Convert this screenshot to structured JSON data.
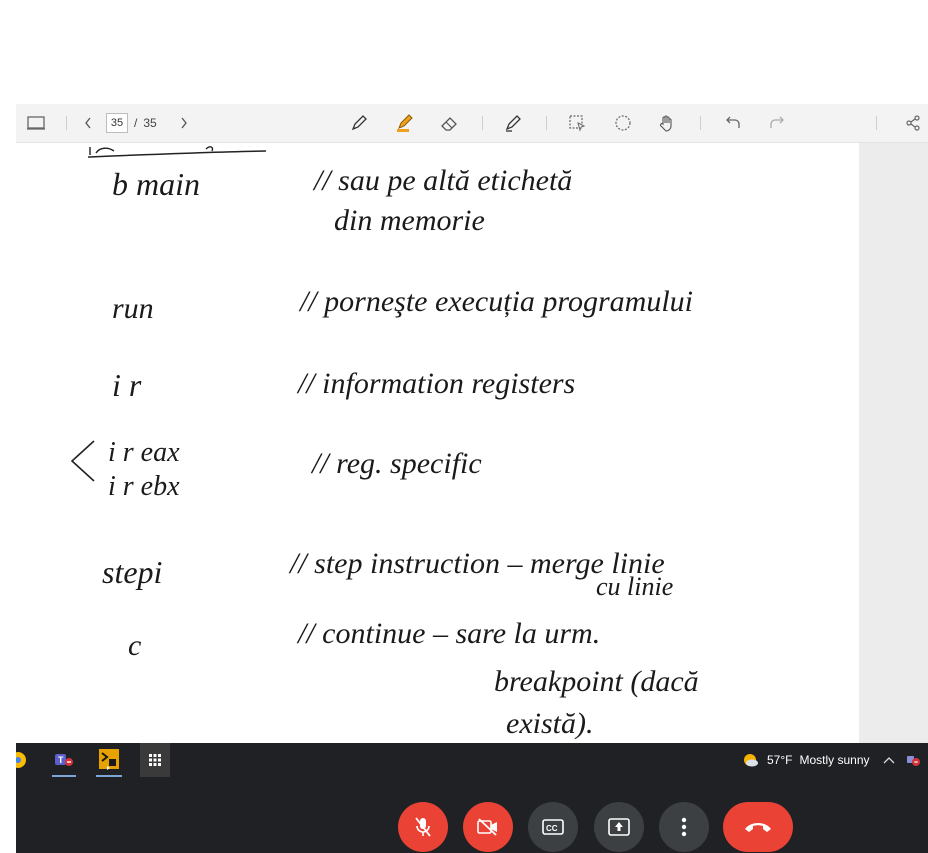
{
  "pdf_toolbar": {
    "current_page": "35",
    "total_pages": "35",
    "separator": "/"
  },
  "notes": {
    "lines": [
      {
        "cmd": "b  main",
        "comment": "// sau pe altă etichetă",
        "comment2": "din memorie"
      },
      {
        "cmd": "run",
        "comment": "// porneşte execuția programului"
      },
      {
        "cmd": "i r",
        "comment": "// information registers"
      },
      {
        "cmd": "i r eax",
        "cmd2": "i r ebx",
        "comment": "// reg. specific"
      },
      {
        "cmd": "stepi",
        "comment": "// step instruction – merge linie",
        "comment2": "cu linie"
      },
      {
        "cmd": "c",
        "comment": "// continue – sare la urm.",
        "comment2": "breakpoint (dacă",
        "comment3": "există)."
      }
    ]
  },
  "taskbar": {
    "weather_temp": "57°F",
    "weather_text": "Mostly sunny"
  },
  "colors": {
    "pen_orange": "#f0a020",
    "end_call_red": "#ea4335",
    "taskbar_bg": "#202124"
  }
}
